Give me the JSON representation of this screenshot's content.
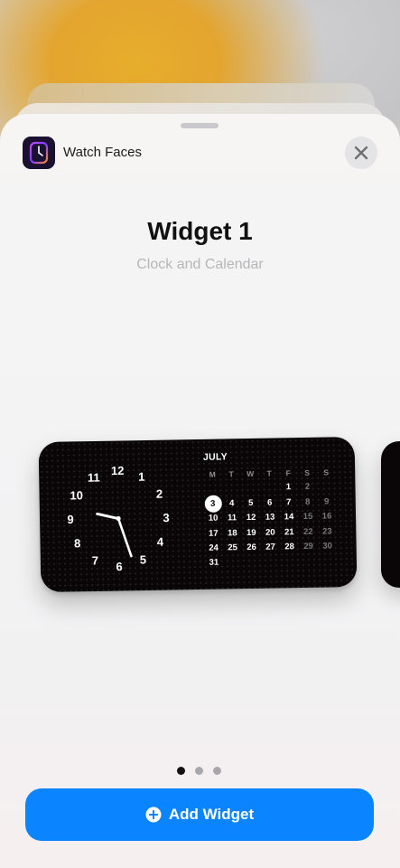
{
  "app": {
    "name": "Watch Faces",
    "icon": "watch-faces-app-icon"
  },
  "close": {
    "icon": "close-icon"
  },
  "widget": {
    "title": "Widget 1",
    "subtitle": "Clock and Calendar"
  },
  "clock": {
    "numbers": [
      "12",
      "1",
      "2",
      "3",
      "4",
      "5",
      "6",
      "7",
      "8",
      "9",
      "10",
      "11"
    ],
    "time": "9:27"
  },
  "calendar": {
    "month": "JULY",
    "weekdays": [
      "M",
      "T",
      "W",
      "T",
      "F",
      "S",
      "S"
    ],
    "today": "3",
    "weeks": [
      [
        "",
        "",
        "",
        "",
        "1",
        "2",
        ""
      ],
      [
        "3",
        "4",
        "5",
        "6",
        "7",
        "8",
        "9"
      ],
      [
        "10",
        "11",
        "12",
        "13",
        "14",
        "15",
        "16"
      ],
      [
        "17",
        "18",
        "19",
        "20",
        "21",
        "22",
        "23"
      ],
      [
        "24",
        "25",
        "26",
        "27",
        "28",
        "29",
        "30"
      ],
      [
        "31",
        "",
        "",
        "",
        "",
        "",
        ""
      ]
    ]
  },
  "pager": {
    "count": 3,
    "active": 0
  },
  "add_button": {
    "label": "Add Widget",
    "icon": "plus-circle-icon"
  },
  "colors": {
    "accent": "#0a84ff",
    "widget_bg": "#0a0608",
    "sheet_bg": "#f3f3f4"
  }
}
